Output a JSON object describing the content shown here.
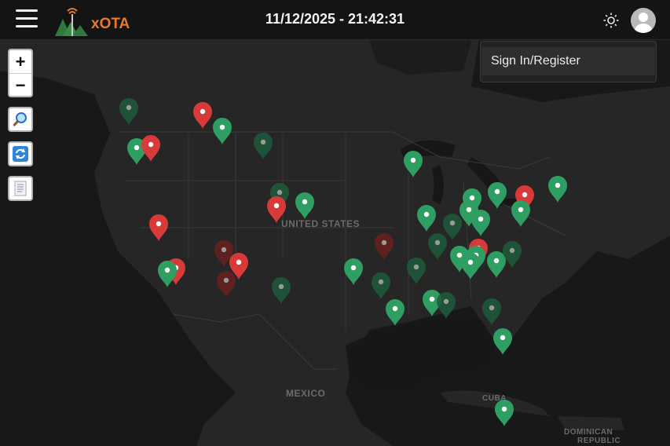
{
  "header": {
    "menu_icon": "hamburger-icon",
    "logo_text": "xOTA",
    "datetime": "11/12/2025 - 21:42:31",
    "theme_icon": "sun-icon",
    "avatar_icon": "user-avatar-icon"
  },
  "user_menu": {
    "signin_label": "Sign In/Register"
  },
  "map": {
    "labels": {
      "country": "UNITED STATES",
      "mexico": "MEXICO",
      "cuba": "CUBA",
      "dominican": "DOMINICAN",
      "republic": "REPUBLIC"
    },
    "controls": {
      "zoom_in": "+",
      "zoom_out": "−",
      "search_icon": "magnifier-icon",
      "refresh_icon": "refresh-icon",
      "list_icon": "document-list-icon"
    },
    "marker_colors": {
      "active_green": "#2f9e63",
      "spotted_red": "#d83a3a",
      "dim_green": "#1f5c3b",
      "dim_red": "#6a2020"
    }
  }
}
